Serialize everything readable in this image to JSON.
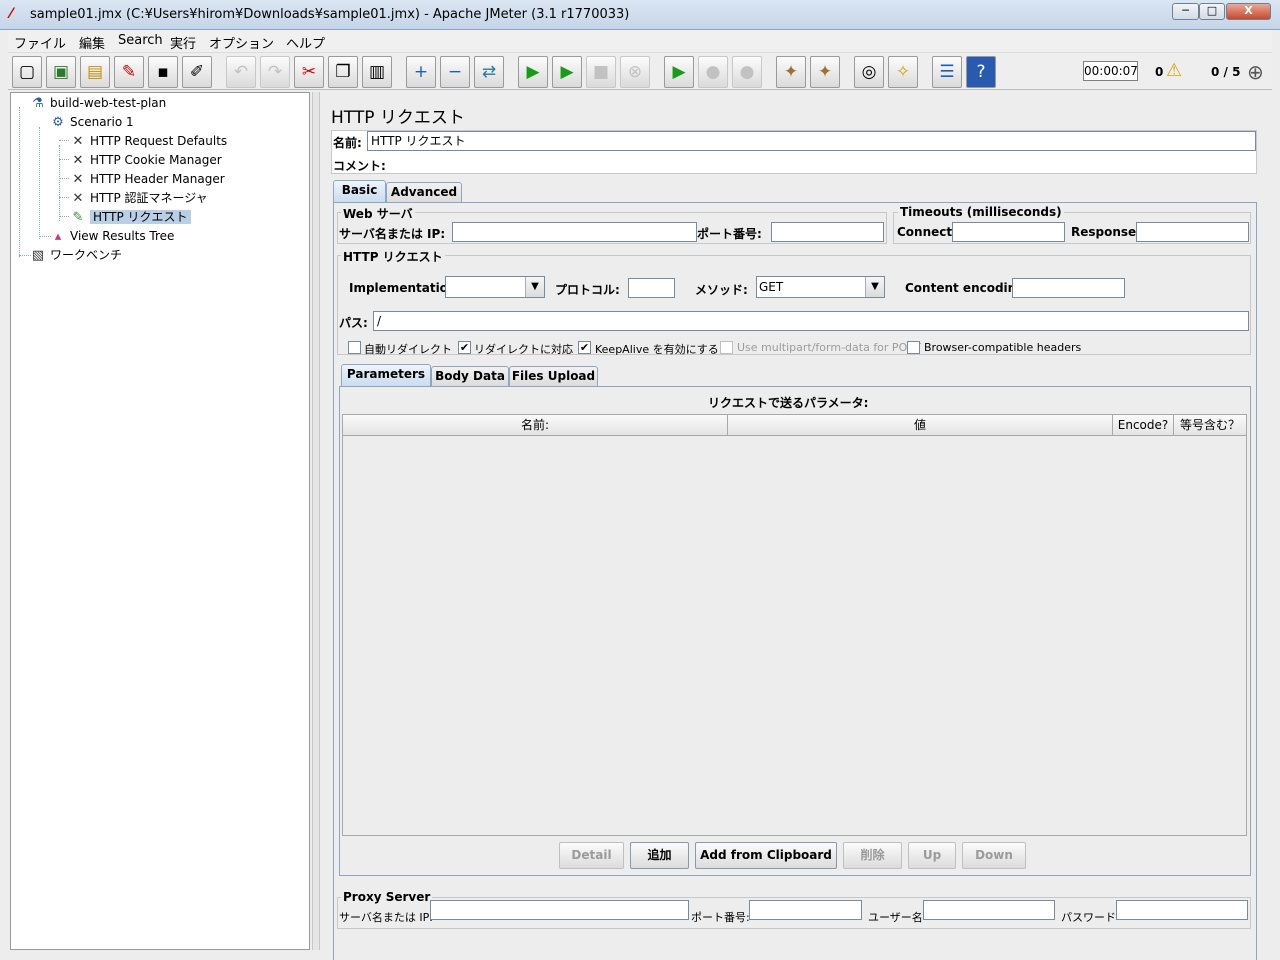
{
  "window": {
    "title": "sample01.jmx (C:¥Users¥hirom¥Downloads¥sample01.jmx) - Apache JMeter (3.1 r1770033)",
    "min": "─",
    "max": "□",
    "close": "X"
  },
  "menu": [
    "ファイル",
    "編集",
    "Search",
    "実行",
    "オプション",
    "ヘルプ"
  ],
  "toolbar": {
    "icons": [
      "new-icon",
      "templates-icon",
      "open-icon",
      "close-file-icon",
      "save-icon",
      "save-as-icon",
      "undo-icon",
      "redo-icon",
      "cut-icon",
      "copy-icon",
      "paste-icon",
      "expand-icon",
      "collapse-icon",
      "toggle-icon",
      "start-icon",
      "start-no-pauses-icon",
      "stop-icon",
      "shutdown-icon",
      "remote-start-icon",
      "remote-stop-icon",
      "remote-shutdown-icon",
      "clear-icon",
      "clear-all-icon",
      "search-icon",
      "reset-search-icon",
      "function-helper-icon",
      "help-icon"
    ],
    "glyphs": [
      "▢",
      "▣",
      "▤",
      "✎",
      "▪",
      "✐",
      "↶",
      "↷",
      "✂",
      "❐",
      "▥",
      "+",
      "−",
      "⇄",
      "▶",
      "▶",
      "■",
      "⊗",
      "▶",
      "●",
      "●",
      "✦",
      "✦",
      "◎",
      "✧",
      "☰",
      "?"
    ],
    "timer": "00:00:07",
    "error_count": "0",
    "warn_icon": "⚠",
    "threads": "0 / 5",
    "remote_icon": "⊕"
  },
  "tree": [
    {
      "label": "build-web-test-plan",
      "icon": "test-plan-icon",
      "glyph": "⚗"
    },
    {
      "label": "Scenario 1",
      "icon": "thread-group-icon",
      "glyph": "⚙"
    },
    {
      "label": "HTTP Request Defaults",
      "icon": "config-icon",
      "glyph": "✕"
    },
    {
      "label": "HTTP Cookie Manager",
      "icon": "config-icon",
      "glyph": "✕"
    },
    {
      "label": "HTTP Header Manager",
      "icon": "config-icon",
      "glyph": "✕"
    },
    {
      "label": "HTTP 認証マネージャ",
      "icon": "config-icon",
      "glyph": "✕"
    },
    {
      "label": "HTTP リクエスト",
      "icon": "sampler-icon",
      "glyph": "✎"
    },
    {
      "label": "View Results Tree",
      "icon": "listener-icon",
      "glyph": "▴"
    },
    {
      "label": "ワークベンチ",
      "icon": "workbench-icon",
      "glyph": "▧"
    }
  ],
  "editor": {
    "title": "HTTP リクエスト",
    "name_label": "名前:",
    "name_value": "HTTP リクエスト",
    "comment_label": "コメント:",
    "tabs": [
      "Basic",
      "Advanced"
    ],
    "web_server": {
      "title": "Web サーバ",
      "server_label": "サーバ名または IP:",
      "port_label": "ポート番号:"
    },
    "timeouts": {
      "title": "Timeouts (milliseconds)",
      "connect_label": "Connect:",
      "response_label": "Response:"
    },
    "http_request": {
      "title": "HTTP リクエスト",
      "impl_label": "Implementation:",
      "impl_value": "",
      "protocol_label": "プロトコル:",
      "method_label": "メソッド:",
      "method_value": "GET",
      "encoding_label": "Content encoding:",
      "path_label": "パス:",
      "path_value": "/"
    },
    "options": [
      {
        "label": "自動リダイレクト",
        "checked": false
      },
      {
        "label": "リダイレクトに対応",
        "checked": true
      },
      {
        "label": "KeepAlive を有効にする",
        "checked": true
      },
      {
        "label": "Use multipart/form-data for POST",
        "checked": false
      },
      {
        "label": "Browser-compatible headers",
        "checked": false
      }
    ],
    "check_mark": "✔",
    "param_tabs": [
      "Parameters",
      "Body Data",
      "Files Upload"
    ],
    "params_caption": "リクエストで送るパラメータ:",
    "columns": [
      "名前:",
      "値",
      "Encode?",
      "等号含む？"
    ],
    "buttons": [
      "Detail",
      "追加",
      "Add from Clipboard",
      "削除",
      "Up",
      "Down"
    ],
    "proxy": {
      "title": "Proxy Server",
      "server_label": "サーバ名または IP:",
      "port_label": "ポート番号:",
      "user_label": "ユーザー名",
      "password_label": "パスワード"
    }
  },
  "colors": {
    "selection": "#b8cfe5",
    "tab_active": "#c9dcf0",
    "play": "#1a9a1a",
    "warn": "#f2c200",
    "close": "#c7482c"
  }
}
